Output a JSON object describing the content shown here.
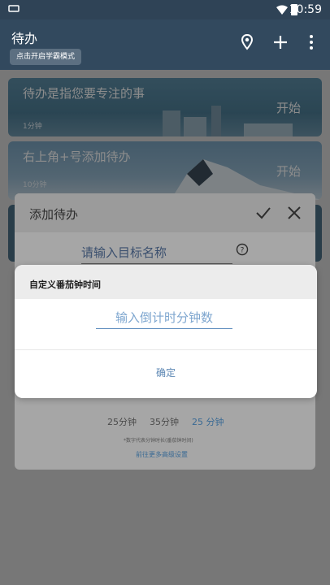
{
  "status_bar": {
    "time": "10:59"
  },
  "app_bar": {
    "title": "待办",
    "chip": "点击开启学霸模式",
    "icons": [
      "location-icon",
      "plus-icon",
      "more-vert-icon"
    ]
  },
  "list": [
    {
      "title": "待办是指您要专注的事",
      "duration": "1分钟",
      "action": "开始"
    },
    {
      "title": "右上角+号添加待办",
      "duration": "10分钟",
      "action": "开始"
    }
  ],
  "add_sheet": {
    "title": "添加待办",
    "name_placeholder": "请输入目标名称",
    "presets": [
      "25分钟",
      "35分钟",
      "25 分钟"
    ],
    "note": "*数字代表分钟时长(番茄钟时间)",
    "settings_link": "前往更多高级设置"
  },
  "dialog": {
    "title": "自定义番茄钟时间",
    "input_placeholder": "输入倒计时分钟数",
    "ok_label": "确定"
  },
  "colors": {
    "app_bar": "#32495e",
    "accent": "#5b86b3",
    "dialog_bg": "#ffffff"
  }
}
